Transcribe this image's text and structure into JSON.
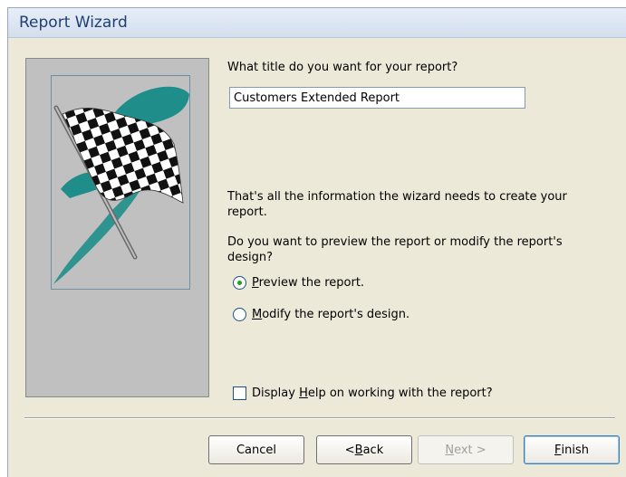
{
  "window": {
    "title": "Report Wizard"
  },
  "title_question": "What title do you want for your report?",
  "report_title_value": "Customers Extended Report",
  "info_text": "That's all the information the wizard needs to create your report.",
  "preview_question": "Do you want to preview the report or modify the report's design?",
  "options": {
    "preview": {
      "accel": "P",
      "rest": "review the report.",
      "selected": true
    },
    "modify": {
      "accel": "M",
      "rest": "odify the report's design.",
      "selected": false
    }
  },
  "help_checkbox": {
    "pre": "Display ",
    "accel": "H",
    "rest": "elp on working with the report?",
    "checked": false
  },
  "buttons": {
    "cancel": "Cancel",
    "back_pre": "< ",
    "back_accel": "B",
    "back_rest": "ack",
    "next_accel": "N",
    "next_rest": "ext >",
    "finish_accel": "F",
    "finish_rest": "inish"
  },
  "icons": {
    "illustration": "checkered-flag-icon"
  },
  "colors": {
    "flag_teal": "#1f8e8a",
    "title_text": "#1f3f73"
  }
}
